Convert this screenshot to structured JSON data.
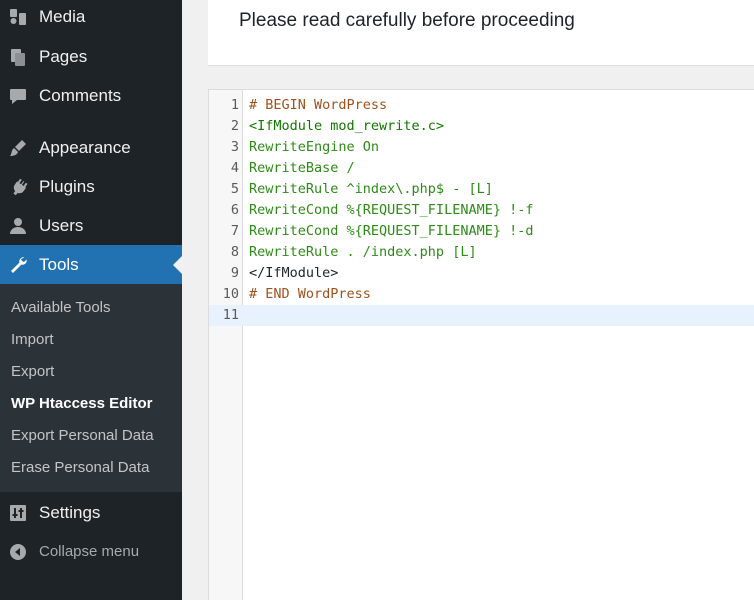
{
  "sidebar": {
    "items": [
      {
        "key": "media",
        "label": "Media",
        "icon": "media-icon"
      },
      {
        "key": "pages",
        "label": "Pages",
        "icon": "pages-icon"
      },
      {
        "key": "comments",
        "label": "Comments",
        "icon": "comments-icon"
      },
      {
        "key": "appearance",
        "label": "Appearance",
        "icon": "appearance-icon"
      },
      {
        "key": "plugins",
        "label": "Plugins",
        "icon": "plugins-icon"
      },
      {
        "key": "users",
        "label": "Users",
        "icon": "users-icon"
      },
      {
        "key": "tools",
        "label": "Tools",
        "icon": "tools-icon",
        "active": true
      },
      {
        "key": "settings",
        "label": "Settings",
        "icon": "settings-icon"
      }
    ],
    "submenu": [
      {
        "label": "Available Tools"
      },
      {
        "label": "Import"
      },
      {
        "label": "Export"
      },
      {
        "label": "WP Htaccess Editor",
        "current": true
      },
      {
        "label": "Export Personal Data"
      },
      {
        "label": "Erase Personal Data"
      }
    ],
    "collapse_label": "Collapse menu",
    "colors": {
      "bg": "#1d2327",
      "active": "#2271b1",
      "submenu_bg": "#2c3338"
    }
  },
  "header": {
    "title": "Please read carefully before proceeding"
  },
  "editor": {
    "active_line": 11,
    "lines": [
      {
        "n": "1",
        "text": "# BEGIN WordPress"
      },
      {
        "n": "2",
        "text": "<IfModule mod_rewrite.c>"
      },
      {
        "n": "3",
        "text": "RewriteEngine On"
      },
      {
        "n": "4",
        "text": "RewriteBase /"
      },
      {
        "n": "5",
        "text": "RewriteRule ^index\\.php$ - [L]"
      },
      {
        "n": "6",
        "text": "RewriteCond %{REQUEST_FILENAME} !-f"
      },
      {
        "n": "7",
        "text": "RewriteCond %{REQUEST_FILENAME} !-d"
      },
      {
        "n": "8",
        "text": "RewriteRule . /index.php [L]"
      },
      {
        "n": "9",
        "text": "</IfModule>"
      },
      {
        "n": "10",
        "text": "# END WordPress"
      },
      {
        "n": "11",
        "text": ""
      }
    ]
  }
}
